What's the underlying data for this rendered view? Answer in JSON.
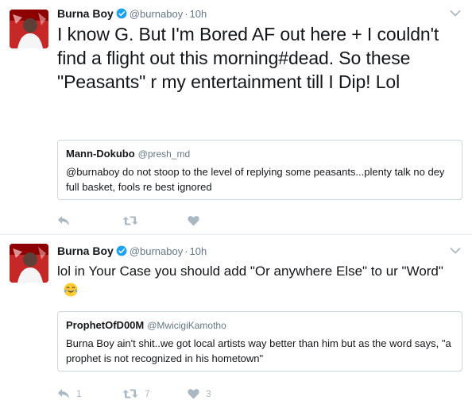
{
  "tweets": [
    {
      "author": {
        "display_name": "Burna Boy",
        "handle": "@burnaboy",
        "verified": true
      },
      "time": "10h",
      "text": "I know G. But I'm Bored AF out here + I couldn't find a flight out this morning#dead. So these \"Peasants\" r my entertainment till I Dip! Lol",
      "quote": {
        "display_name": "Mann-Dokubo",
        "handle": "@presh_md",
        "text": "@burnaboy do not stoop to the level of replying some peasants...plenty talk no dey full basket, fools re best ignored"
      },
      "actions": {
        "reply_count": "",
        "retweet_count": "",
        "like_count": ""
      }
    },
    {
      "author": {
        "display_name": "Burna Boy",
        "handle": "@burnaboy",
        "verified": true
      },
      "time": "10h",
      "text": "lol in Your Case you should add \"Or anywhere Else\" to ur \"Word\"",
      "emoji": "face-with-tears-of-joy",
      "quote": {
        "display_name": "ProphetOfD00M",
        "handle": "@MwicigiKamotho",
        "text": "Burna Boy ain't shit..we got local artists way better than him but as the word says, \"a prophet is not recognized in his hometown\""
      },
      "actions": {
        "reply_count": "1",
        "retweet_count": "7",
        "like_count": "3"
      }
    }
  ],
  "colors": {
    "verified": "#1da1f2",
    "muted_text": "#657786",
    "action_icon": "#aab8c2",
    "divider": "#e6ecf0",
    "quote_border": "#ccd6dd"
  },
  "icons": [
    "avatar",
    "verified-badge-icon",
    "chevron-down-icon",
    "reply-icon",
    "retweet-icon",
    "heart-icon",
    "face-with-tears-of-joy-emoji"
  ],
  "separator": "·"
}
